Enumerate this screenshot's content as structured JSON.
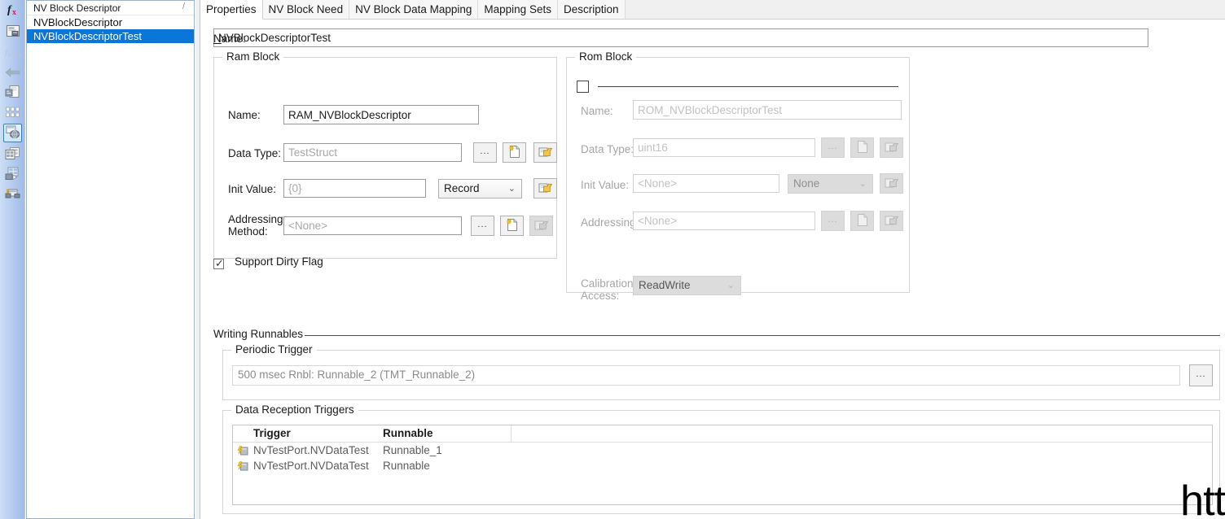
{
  "toolbar": {
    "items": [
      {
        "name": "function-fx-icon",
        "label": "fx"
      },
      {
        "name": "component-icon",
        "label": ""
      },
      {
        "name": "function-chain-icon",
        "label": "fxfx"
      },
      {
        "name": "arrow-left-icon",
        "label": ""
      },
      {
        "name": "document-export-icon",
        "label": ""
      },
      {
        "name": "grid-dots-icon",
        "label": ""
      },
      {
        "name": "nv-block-descriptor-icon",
        "label": "",
        "selected": true
      },
      {
        "name": "table-copy-icon",
        "label": ""
      },
      {
        "name": "table-play-icon",
        "label": ""
      },
      {
        "name": "device-connect-icon",
        "label": ""
      }
    ]
  },
  "list_panel": {
    "header": "NV Block Descriptor",
    "header_marker": "/",
    "items": [
      {
        "label": "NVBlockDescriptor",
        "selected": false
      },
      {
        "label": "NVBlockDescriptorTest",
        "selected": true
      }
    ]
  },
  "tabs": [
    {
      "label": "Properties",
      "active": true
    },
    {
      "label": "NV Block Need",
      "active": false
    },
    {
      "label": "NV Block Data Mapping",
      "active": false
    },
    {
      "label": "Mapping Sets",
      "active": false
    },
    {
      "label": "Description",
      "active": false
    }
  ],
  "name_field": {
    "label_prefix": "N",
    "label_rest": "ame:",
    "value": "NVBlockDescriptorTest"
  },
  "ram_block": {
    "title": "Ram Block",
    "name": {
      "label": "Name:",
      "value": "RAM_NVBlockDescriptor"
    },
    "data_type": {
      "label": "Data Type:",
      "value": "TestStruct",
      "browse": "...",
      "new_icon": "new-document-icon",
      "open_icon": "open-folder-icon"
    },
    "init_value": {
      "label": "Init Value:",
      "value": "{0}",
      "kind": "Record",
      "open_icon": "open-folder-icon"
    },
    "addressing_method": {
      "label_line1": "Addressing",
      "label_line2": "Method:",
      "value": "<None>",
      "browse": "...",
      "new_icon": "new-document-icon",
      "open_icon": "open-folder-icon"
    },
    "support_dirty_flag": {
      "label": "Support Dirty Flag",
      "checked": true
    }
  },
  "rom_block": {
    "title": "Rom Block",
    "enabled": false,
    "name": {
      "label": "Name:",
      "value": "ROM_NVBlockDescriptorTest"
    },
    "data_type": {
      "label": "Data Type:",
      "value": "uint16",
      "browse": "...",
      "new_icon": "new-document-icon",
      "open_icon": "open-folder-icon"
    },
    "init_value": {
      "label": "Init Value:",
      "value": "<None>",
      "kind": "None",
      "open_icon": "open-folder-icon"
    },
    "addressing_method": {
      "label": "Addressing",
      "value": "<None>",
      "browse": "...",
      "new_icon": "new-document-icon",
      "open_icon": "open-folder-icon"
    },
    "calibration_access": {
      "label_line1": "Calibration",
      "label_line2": "Access:",
      "value": "ReadWrite"
    }
  },
  "writing_runnables": {
    "title": "Writing Runnables",
    "periodic_trigger": {
      "title": "Periodic Trigger",
      "value": "500 msec Rnbl: Runnable_2 (TMT_Runnable_2)",
      "browse": "..."
    },
    "data_reception_triggers": {
      "title": "Data Reception Triggers",
      "columns": [
        "Trigger",
        "Runnable"
      ],
      "rows": [
        {
          "icon": "trigger-event-icon",
          "trigger": "NvTestPort.NVDataTest",
          "runnable": "Runnable_1"
        },
        {
          "icon": "trigger-event-icon",
          "trigger": "NvTestPort.NVDataTest",
          "runnable": "Runnable"
        }
      ]
    }
  },
  "watermark": {
    "text": "htt"
  },
  "colors": {
    "selection_blue": "#0b76d9",
    "sidebar_blue_light": "#cddef5",
    "sidebar_blue_dark": "#9fbce8",
    "disabled_text": "#b5b5b5",
    "group_border": "#d6d6d6"
  }
}
